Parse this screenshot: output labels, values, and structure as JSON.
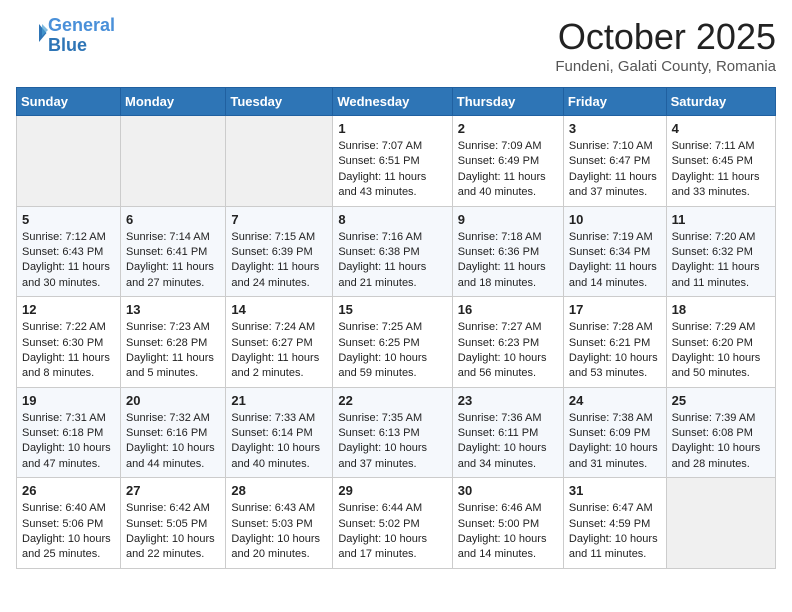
{
  "header": {
    "logo_line1": "General",
    "logo_line2": "Blue",
    "title": "October 2025",
    "subtitle": "Fundeni, Galati County, Romania"
  },
  "days_of_week": [
    "Sunday",
    "Monday",
    "Tuesday",
    "Wednesday",
    "Thursday",
    "Friday",
    "Saturday"
  ],
  "weeks": [
    [
      {
        "day": "",
        "info": ""
      },
      {
        "day": "",
        "info": ""
      },
      {
        "day": "",
        "info": ""
      },
      {
        "day": "1",
        "info": "Sunrise: 7:07 AM\nSunset: 6:51 PM\nDaylight: 11 hours and 43 minutes."
      },
      {
        "day": "2",
        "info": "Sunrise: 7:09 AM\nSunset: 6:49 PM\nDaylight: 11 hours and 40 minutes."
      },
      {
        "day": "3",
        "info": "Sunrise: 7:10 AM\nSunset: 6:47 PM\nDaylight: 11 hours and 37 minutes."
      },
      {
        "day": "4",
        "info": "Sunrise: 7:11 AM\nSunset: 6:45 PM\nDaylight: 11 hours and 33 minutes."
      }
    ],
    [
      {
        "day": "5",
        "info": "Sunrise: 7:12 AM\nSunset: 6:43 PM\nDaylight: 11 hours and 30 minutes."
      },
      {
        "day": "6",
        "info": "Sunrise: 7:14 AM\nSunset: 6:41 PM\nDaylight: 11 hours and 27 minutes."
      },
      {
        "day": "7",
        "info": "Sunrise: 7:15 AM\nSunset: 6:39 PM\nDaylight: 11 hours and 24 minutes."
      },
      {
        "day": "8",
        "info": "Sunrise: 7:16 AM\nSunset: 6:38 PM\nDaylight: 11 hours and 21 minutes."
      },
      {
        "day": "9",
        "info": "Sunrise: 7:18 AM\nSunset: 6:36 PM\nDaylight: 11 hours and 18 minutes."
      },
      {
        "day": "10",
        "info": "Sunrise: 7:19 AM\nSunset: 6:34 PM\nDaylight: 11 hours and 14 minutes."
      },
      {
        "day": "11",
        "info": "Sunrise: 7:20 AM\nSunset: 6:32 PM\nDaylight: 11 hours and 11 minutes."
      }
    ],
    [
      {
        "day": "12",
        "info": "Sunrise: 7:22 AM\nSunset: 6:30 PM\nDaylight: 11 hours and 8 minutes."
      },
      {
        "day": "13",
        "info": "Sunrise: 7:23 AM\nSunset: 6:28 PM\nDaylight: 11 hours and 5 minutes."
      },
      {
        "day": "14",
        "info": "Sunrise: 7:24 AM\nSunset: 6:27 PM\nDaylight: 11 hours and 2 minutes."
      },
      {
        "day": "15",
        "info": "Sunrise: 7:25 AM\nSunset: 6:25 PM\nDaylight: 10 hours and 59 minutes."
      },
      {
        "day": "16",
        "info": "Sunrise: 7:27 AM\nSunset: 6:23 PM\nDaylight: 10 hours and 56 minutes."
      },
      {
        "day": "17",
        "info": "Sunrise: 7:28 AM\nSunset: 6:21 PM\nDaylight: 10 hours and 53 minutes."
      },
      {
        "day": "18",
        "info": "Sunrise: 7:29 AM\nSunset: 6:20 PM\nDaylight: 10 hours and 50 minutes."
      }
    ],
    [
      {
        "day": "19",
        "info": "Sunrise: 7:31 AM\nSunset: 6:18 PM\nDaylight: 10 hours and 47 minutes."
      },
      {
        "day": "20",
        "info": "Sunrise: 7:32 AM\nSunset: 6:16 PM\nDaylight: 10 hours and 44 minutes."
      },
      {
        "day": "21",
        "info": "Sunrise: 7:33 AM\nSunset: 6:14 PM\nDaylight: 10 hours and 40 minutes."
      },
      {
        "day": "22",
        "info": "Sunrise: 7:35 AM\nSunset: 6:13 PM\nDaylight: 10 hours and 37 minutes."
      },
      {
        "day": "23",
        "info": "Sunrise: 7:36 AM\nSunset: 6:11 PM\nDaylight: 10 hours and 34 minutes."
      },
      {
        "day": "24",
        "info": "Sunrise: 7:38 AM\nSunset: 6:09 PM\nDaylight: 10 hours and 31 minutes."
      },
      {
        "day": "25",
        "info": "Sunrise: 7:39 AM\nSunset: 6:08 PM\nDaylight: 10 hours and 28 minutes."
      }
    ],
    [
      {
        "day": "26",
        "info": "Sunrise: 6:40 AM\nSunset: 5:06 PM\nDaylight: 10 hours and 25 minutes."
      },
      {
        "day": "27",
        "info": "Sunrise: 6:42 AM\nSunset: 5:05 PM\nDaylight: 10 hours and 22 minutes."
      },
      {
        "day": "28",
        "info": "Sunrise: 6:43 AM\nSunset: 5:03 PM\nDaylight: 10 hours and 20 minutes."
      },
      {
        "day": "29",
        "info": "Sunrise: 6:44 AM\nSunset: 5:02 PM\nDaylight: 10 hours and 17 minutes."
      },
      {
        "day": "30",
        "info": "Sunrise: 6:46 AM\nSunset: 5:00 PM\nDaylight: 10 hours and 14 minutes."
      },
      {
        "day": "31",
        "info": "Sunrise: 6:47 AM\nSunset: 4:59 PM\nDaylight: 10 hours and 11 minutes."
      },
      {
        "day": "",
        "info": ""
      }
    ]
  ]
}
